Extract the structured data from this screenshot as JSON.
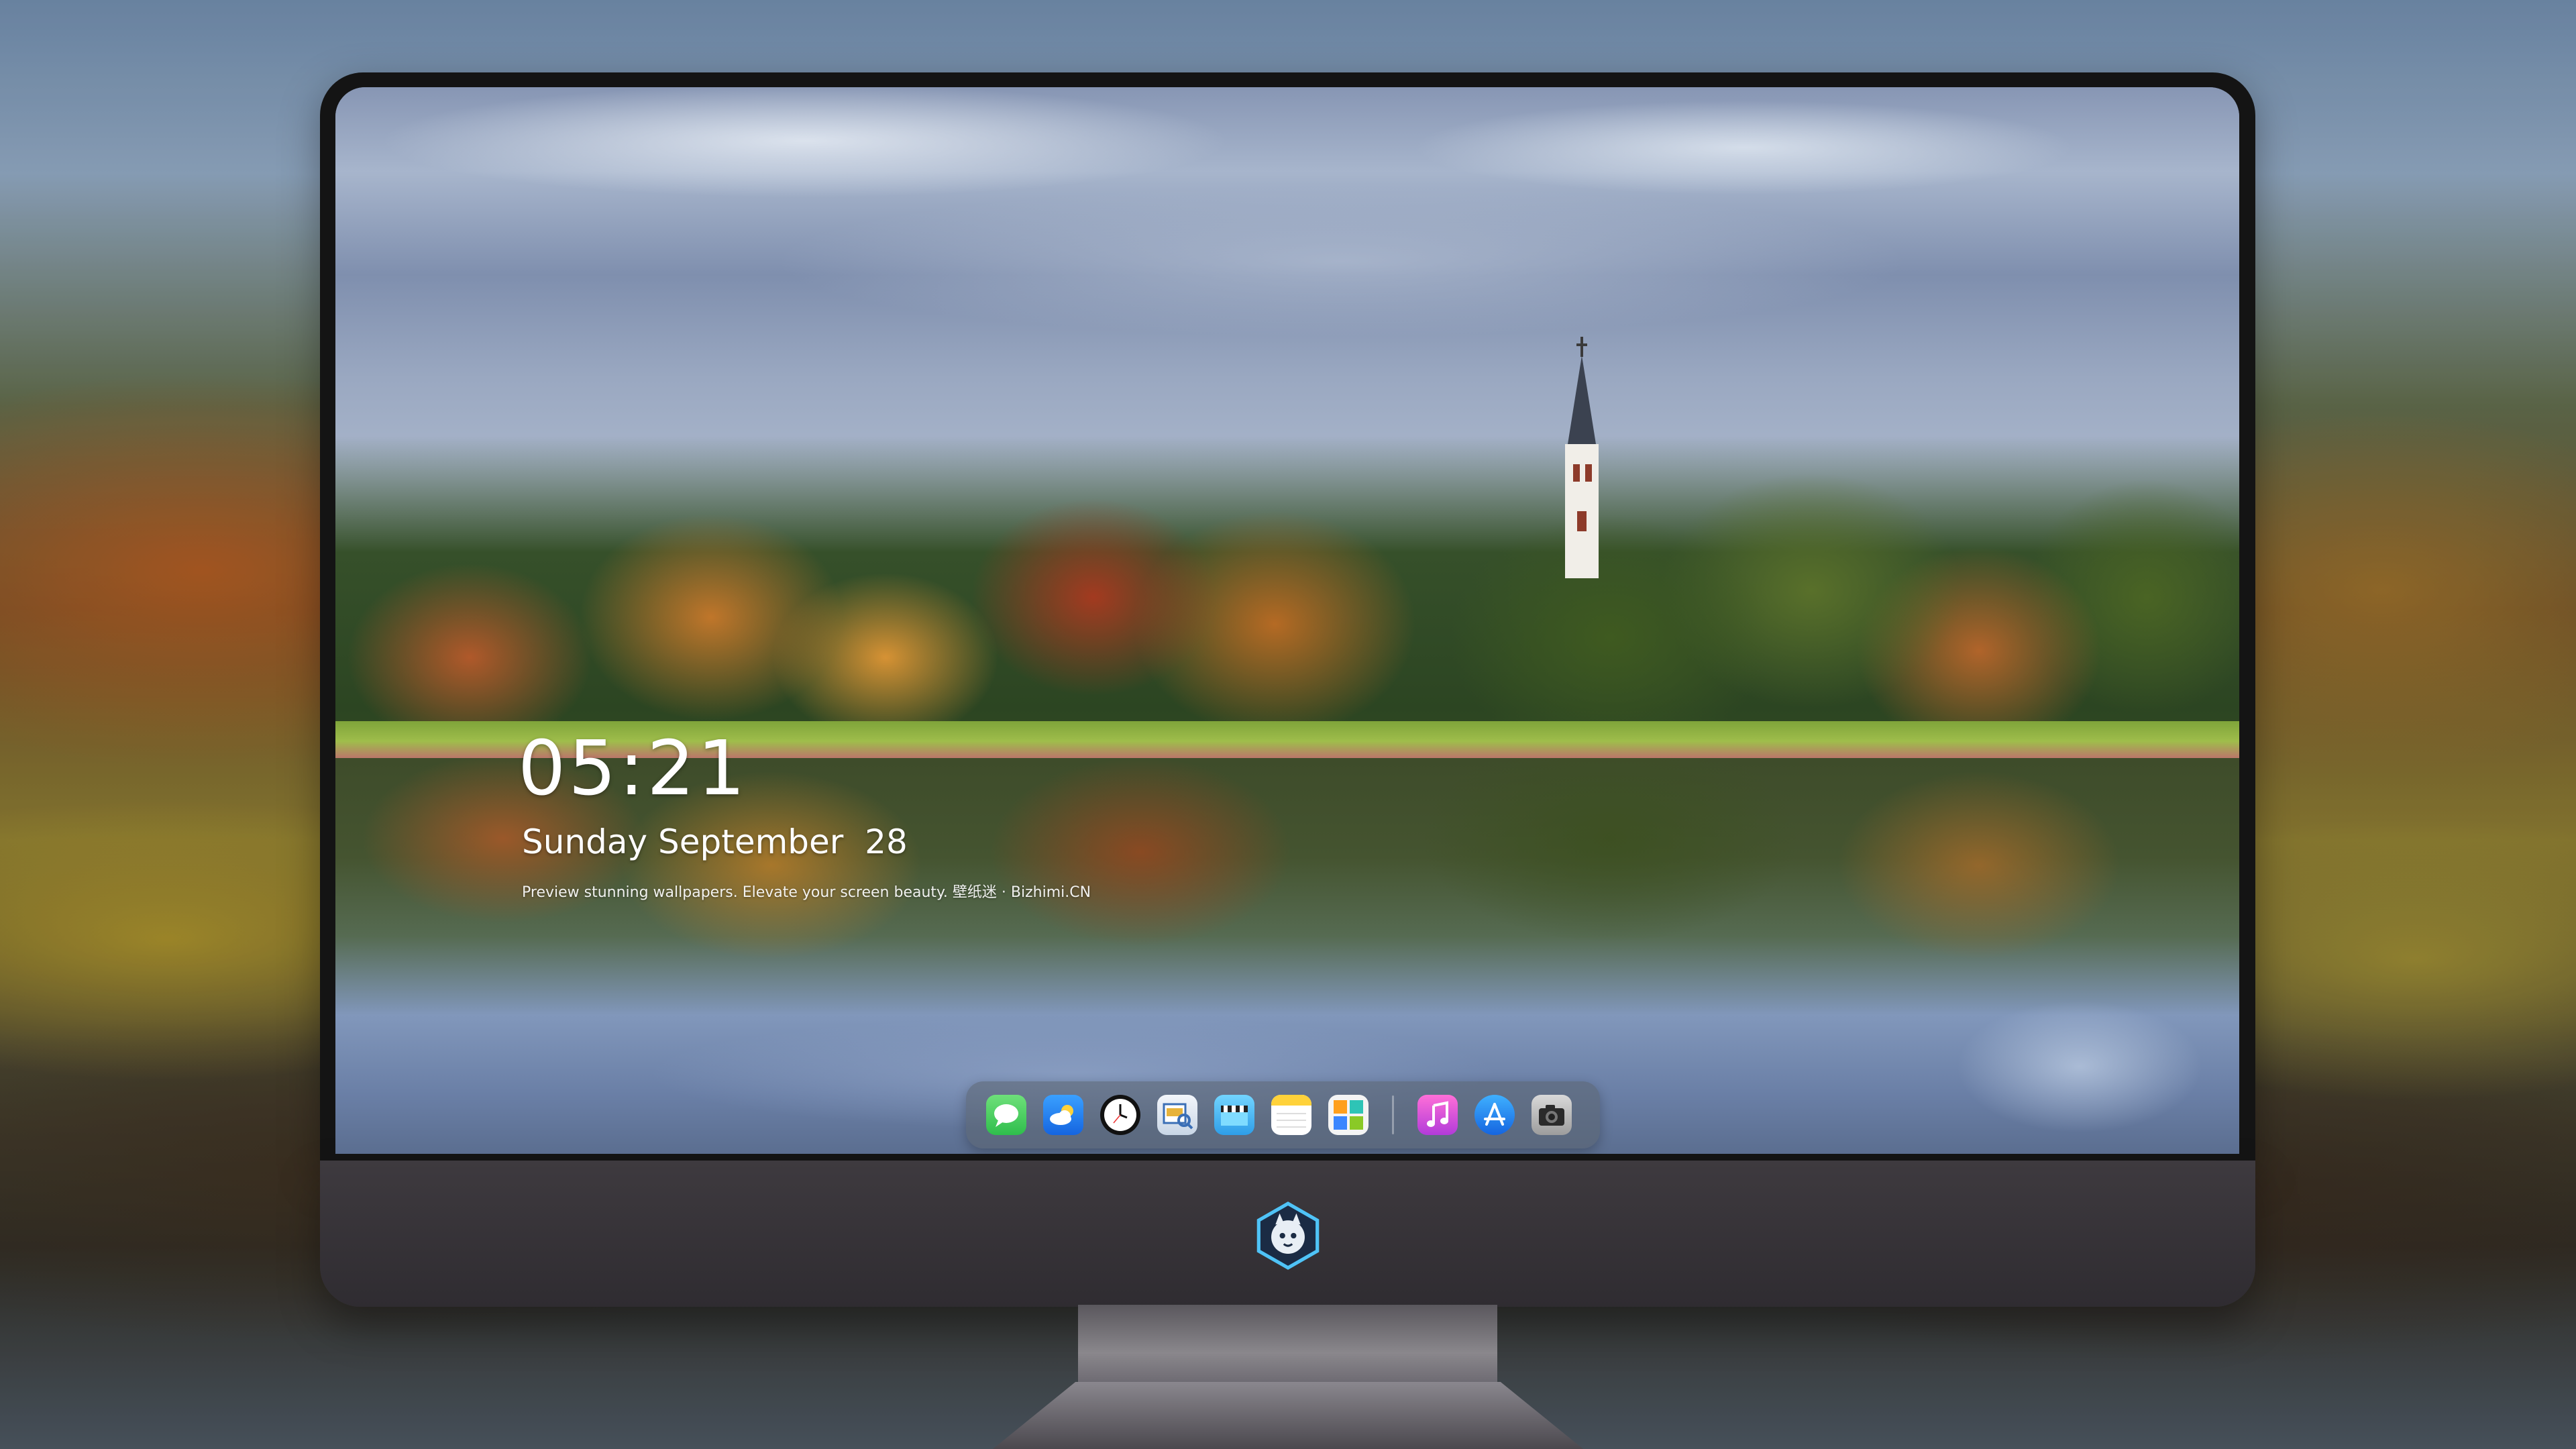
{
  "lock_screen": {
    "time": "05:21",
    "date": "Sunday September  28",
    "tagline": "Preview stunning wallpapers. Elevate your screen beauty. 壁纸迷 · Bizhimi.CN"
  },
  "dock": {
    "apps": [
      {
        "name": "messages-icon"
      },
      {
        "name": "weather-icon"
      },
      {
        "name": "clock-icon"
      },
      {
        "name": "preview-icon"
      },
      {
        "name": "clips-icon"
      },
      {
        "name": "notes-icon"
      },
      {
        "name": "photo-booth-icon"
      },
      {
        "name": "itunes-icon"
      },
      {
        "name": "app-store-icon"
      },
      {
        "name": "camera-icon"
      }
    ]
  },
  "colors": {
    "messages": "#35c759",
    "weather": "#1e88ff",
    "itunes": "#e94fd6",
    "app_store": "#1a8cff",
    "dock_bg": "rgba(90,98,110,0.55)"
  }
}
